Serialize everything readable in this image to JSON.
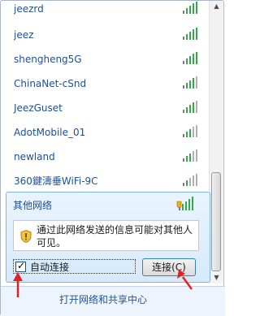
{
  "networks": [
    {
      "name": "jeezrd"
    },
    {
      "name": "jeez"
    },
    {
      "name": "shengheng5G"
    },
    {
      "name": "ChinaNet-cSnd"
    },
    {
      "name": "JeezGuset"
    },
    {
      "name": "AdotMobile_01"
    },
    {
      "name": "newland"
    },
    {
      "name": "360鍵濤垂WiFi-9C"
    }
  ],
  "expanded": {
    "name": "其他网络",
    "warning": "通过此网络发送的信息可能对其他人可见。",
    "auto_connect_label": "自动连接",
    "auto_connect_checked": true,
    "connect_label": "连接(C)"
  },
  "footer": {
    "link_label": "打开网络和共享中心"
  },
  "colors": {
    "link": "#1e4f92",
    "signal": "#36a84a",
    "warning": "#f2b01e",
    "annotation": "#e22222"
  },
  "icons": [
    "wifi-signal-icon",
    "shield-warning-icon",
    "scroll-up-icon",
    "scroll-down-icon"
  ]
}
